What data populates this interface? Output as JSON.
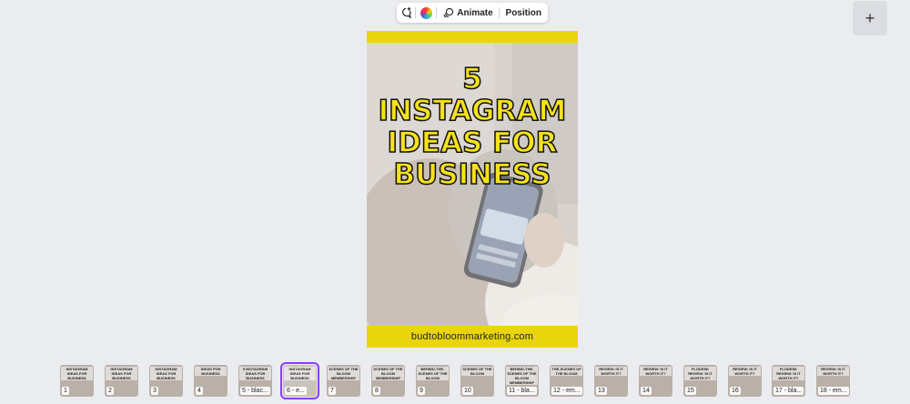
{
  "toolbar": {
    "comment_icon": "comment-add-icon",
    "color_icon": "color-palette-icon",
    "animate_label": "Animate",
    "position_label": "Position"
  },
  "page": {
    "headline_lines": [
      "5",
      "INSTAGRAM",
      "IDEAS FOR",
      "BUSINESS"
    ],
    "website": "budtobloommarketing.com",
    "accent_color": "#e9d50d",
    "text_color": "#f5e21a"
  },
  "pages": [
    {
      "num": "1",
      "text": "INSTAGRAM IDEAS FOR BUSINESS"
    },
    {
      "num": "2",
      "text": "INSTAGRAM IDEAS FOR BUSINESS"
    },
    {
      "num": "3",
      "text": "INSTAGRAM IDEAS FOR BUSINESS"
    },
    {
      "num": "4",
      "text": "IDEAS FOR BUSINESS"
    },
    {
      "num": "5 - blac...",
      "text": "5 INSTAGRAM IDEAS FOR BUSINESS"
    },
    {
      "num": "6 - e...",
      "text": "INSTAGRAM IDEAS FOR BUSINESS"
    },
    {
      "num": "7",
      "text": "SCENES OF THE BLOOM MEMBERSHIP"
    },
    {
      "num": "8",
      "text": "SCENES OF THE BLOOM MEMBERSHIP"
    },
    {
      "num": "9",
      "text": "BEHIND-THE-SCENES OF THE BLOOM"
    },
    {
      "num": "10",
      "text": "SCENES OF THE BLOOM"
    },
    {
      "num": "11 - bla...",
      "text": "BEHIND-THE-SCENES OF THE BLOOM MEMBERSHIP"
    },
    {
      "num": "12 - em...",
      "text": "THE-SCENES OF THE BLOOM"
    },
    {
      "num": "13",
      "text": "REVIEW: IS IT WORTH IT?"
    },
    {
      "num": "14",
      "text": "REVIEW: IS IT WORTH IT?"
    },
    {
      "num": "15",
      "text": "FLODESK REVIEW: IS IT WORTH IT?"
    },
    {
      "num": "16",
      "text": "REVIEW: IS IT WORTH IT?"
    },
    {
      "num": "17 - bla...",
      "text": "FLODESK REVIEW: IS IT WORTH IT?"
    },
    {
      "num": "18 - em...",
      "text": "REVIEW: IS IT WORTH IT?"
    }
  ],
  "add_page_label": "+"
}
